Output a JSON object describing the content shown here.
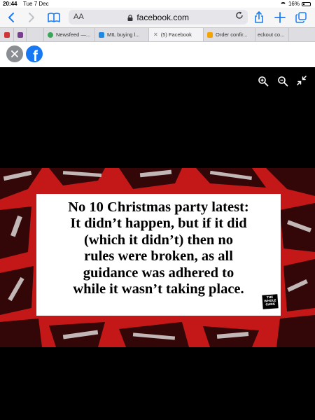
{
  "status_bar": {
    "time": "20:44",
    "date": "Tue 7 Dec",
    "battery": "16%"
  },
  "toolbar": {
    "text_size": "AA",
    "url": "facebook.com"
  },
  "tabs": [
    {
      "label": "",
      "favicon_color": "#d13438"
    },
    {
      "label": "",
      "favicon_color": "#7a3c8f"
    },
    {
      "label": "Newsfeed —...",
      "favicon_color": "#3aa757"
    },
    {
      "label": "MIL buying l...",
      "favicon_color": "#1e88e5"
    },
    {
      "label": "(5) Facebook",
      "favicon_color": "#e6e6e6",
      "active": true
    },
    {
      "label": "Order confir...",
      "favicon_color": "#f4a300"
    },
    {
      "label": "eckout co...",
      "favicon_color": "#dddddd"
    }
  ],
  "page_header": {
    "logo": "f"
  },
  "poster": {
    "caption_lines": [
      "No 10 Christmas party latest:",
      "It didn’t happen, but if it did",
      "(which it didn’t) then no",
      "rules were broken, as all",
      "guidance was adhered to",
      "while it wasn’t taking place."
    ],
    "stamp_text": "THE WHOLE GANG",
    "background_color": "#c41717"
  },
  "colors": {
    "accent": "#1a7cf5",
    "facebook": "#1877f2"
  }
}
